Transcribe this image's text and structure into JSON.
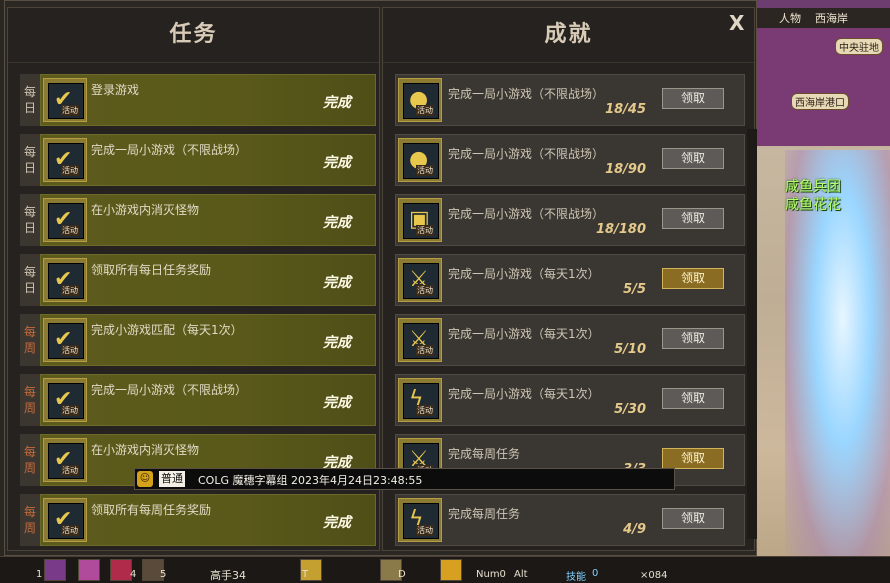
{
  "quest_panel": {
    "title": "任务",
    "rows": [
      {
        "period": "每日",
        "type": "daily",
        "icon": "activity-badge-icon",
        "icon_caption": "活动",
        "name": "登录游戏",
        "status": "完成"
      },
      {
        "period": "每日",
        "type": "daily",
        "icon": "activity-badge-icon",
        "icon_caption": "活动",
        "name": "完成一局小游戏（不限战场）",
        "status": "完成"
      },
      {
        "period": "每日",
        "type": "daily",
        "icon": "activity-badge-icon",
        "icon_caption": "活动",
        "name": "在小游戏内消灭怪物",
        "status": "完成"
      },
      {
        "period": "每日",
        "type": "daily",
        "icon": "activity-badge-icon",
        "icon_caption": "活动",
        "name": "领取所有每日任务奖励",
        "status": "完成"
      },
      {
        "period": "每周",
        "type": "weekly",
        "icon": "activity-badge-icon",
        "icon_caption": "活动",
        "name": "完成小游戏匹配（每天1次）",
        "status": "完成"
      },
      {
        "period": "每周",
        "type": "weekly",
        "icon": "activity-badge-icon",
        "icon_caption": "活动",
        "name": "完成一局小游戏（不限战场）",
        "status": "完成"
      },
      {
        "period": "每周",
        "type": "weekly",
        "icon": "activity-badge-icon",
        "icon_caption": "活动",
        "name": "在小游戏内消灭怪物",
        "status": "完成"
      },
      {
        "period": "每周",
        "type": "weekly",
        "icon": "activity-badge-icon",
        "icon_caption": "活动",
        "name": "领取所有每周任务奖励",
        "status": "完成"
      }
    ]
  },
  "achievement_panel": {
    "title": "成就",
    "rows": [
      {
        "icon": "gold-medal-icon",
        "icon_caption": "活动",
        "name": "完成一局小游戏（不限战场）",
        "progress": "18/45",
        "claim": "领取",
        "claimable": false
      },
      {
        "icon": "gold-medal-icon",
        "icon_caption": "活动",
        "name": "完成一局小游戏（不限战场）",
        "progress": "18/90",
        "claim": "领取",
        "claimable": false
      },
      {
        "icon": "treasure-chest-icon",
        "icon_caption": "活动",
        "name": "完成一局小游戏（不限战场）",
        "progress": "18/180",
        "claim": "领取",
        "claimable": false
      },
      {
        "icon": "sword-icon",
        "icon_caption": "活动",
        "name": "完成一局小游戏（每天1次）",
        "progress": "5/5",
        "claim": "领取",
        "claimable": true
      },
      {
        "icon": "sword-icon",
        "icon_caption": "活动",
        "name": "完成一局小游戏（每天1次）",
        "progress": "5/10",
        "claim": "领取",
        "claimable": false
      },
      {
        "icon": "lightning-icon",
        "icon_caption": "活动",
        "name": "完成一局小游戏（每天1次）",
        "progress": "5/30",
        "claim": "领取",
        "claimable": false
      },
      {
        "icon": "sword-icon",
        "icon_caption": "活动",
        "name": "完成每周任务",
        "progress": "3/3",
        "claim": "领取",
        "claimable": true
      },
      {
        "icon": "lightning-icon",
        "icon_caption": "活动",
        "name": "完成每周任务",
        "progress": "4/9",
        "claim": "领取",
        "claimable": false
      }
    ]
  },
  "close_label": "X",
  "chat_tooltip": {
    "channel": "普通",
    "text": "COLG 魔穗字幕组 2023年4月24日23:48:55"
  },
  "scene": {
    "tab_character": "人物",
    "tab_location": "西海岸",
    "map_labels": [
      "中央驻地",
      "西海岸港口"
    ],
    "guild_name": "咸鱼兵团",
    "guild_member": "咸鱼花花"
  },
  "hotbar": {
    "level_label": "高手34",
    "skill_label": "技能",
    "skill_points": "0",
    "keys": [
      "1",
      "4",
      "5",
      "Num0",
      "Alt",
      "T",
      "D"
    ],
    "x_count": "×084"
  },
  "colors": {
    "quest_row": "#5c5b1c",
    "achievement_row": "#3a3733",
    "weekly_tag": "#c46b3b",
    "claim_active": "#8a6c22"
  }
}
